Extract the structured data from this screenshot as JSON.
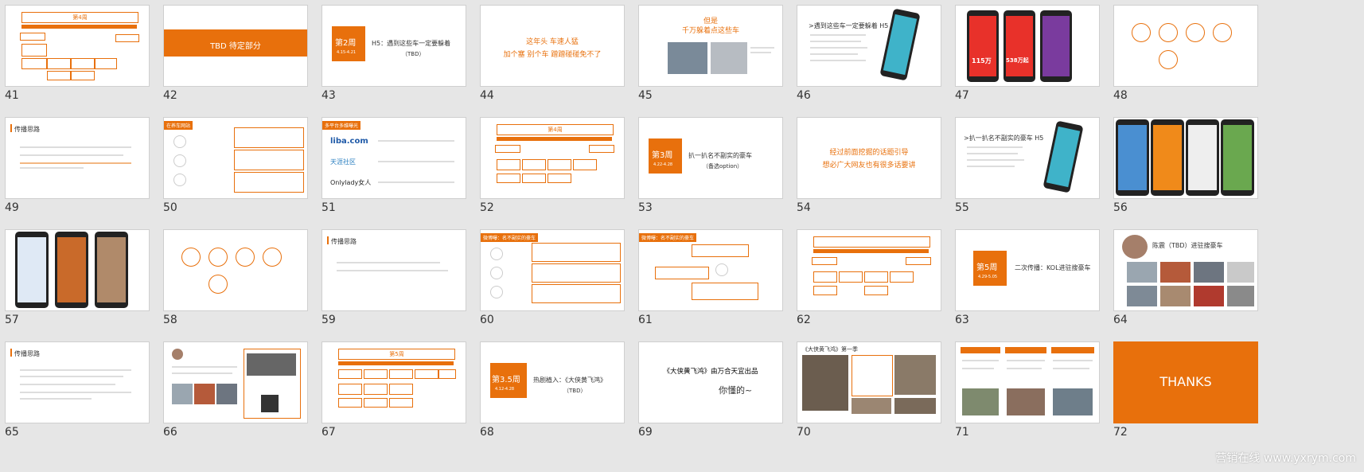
{
  "slides": [
    {
      "num": "41",
      "label": "第4周"
    },
    {
      "num": "42",
      "label": "TBD 待定部分"
    },
    {
      "num": "43",
      "week": "第2周",
      "date": "4.15-4.21",
      "title": "H5：遇到这些车一定要躲着",
      "sub": "（TBD）"
    },
    {
      "num": "44",
      "line1": "这年头 车速人猛",
      "line2": "加个塞 别个车 蹭蹭碰碰免不了"
    },
    {
      "num": "45",
      "line1": "但是",
      "line2": "千万躲着点这些车"
    },
    {
      "num": "46",
      "title": ">遇到这些车一定要躲着 H5"
    },
    {
      "num": "47",
      "price1": "115万",
      "price2": "538万起"
    },
    {
      "num": "48"
    },
    {
      "num": "49",
      "title": "传播思路"
    },
    {
      "num": "50",
      "tag": "在养车网站"
    },
    {
      "num": "51",
      "tag": "多平台多维曝光",
      "logo1": "liba.com",
      "logo2": "天涯社区",
      "logo3": "Onlylady女人"
    },
    {
      "num": "52",
      "label": "第4周"
    },
    {
      "num": "53",
      "week": "第3周",
      "date": "4.22-4.28",
      "title": "扒一扒名不副实的豪车",
      "sub": "（备选option）"
    },
    {
      "num": "54",
      "line1": "经过前面挖掘的话题引导",
      "line2": "想必广大网友也有很多话要讲"
    },
    {
      "num": "55",
      "title": ">扒一扒名不副实的豪车 H5"
    },
    {
      "num": "56"
    },
    {
      "num": "57"
    },
    {
      "num": "58"
    },
    {
      "num": "59",
      "title": "传播思路"
    },
    {
      "num": "60",
      "tag": "微博曝：名不副实的豪车"
    },
    {
      "num": "61",
      "tag": "微博曝：名不副实的豪车"
    },
    {
      "num": "62"
    },
    {
      "num": "63",
      "week": "第5周",
      "date": "4.29-5.05",
      "title": "二次传播：KOL进驻搜豪车"
    },
    {
      "num": "64",
      "title": "陈震（TBD）进驻搜豪车"
    },
    {
      "num": "65",
      "title": "传播思路"
    },
    {
      "num": "66"
    },
    {
      "num": "67",
      "label": "第5周"
    },
    {
      "num": "68",
      "week": "第3.5周",
      "date": "4.12-4.28",
      "title": "热剧植入：《大侠黄飞鸿》",
      "sub": "（TBD）"
    },
    {
      "num": "69",
      "line1": "《大侠黄飞鸿》由万合天宜出品",
      "line2": "你懂的~"
    },
    {
      "num": "70",
      "title": "《大侠黄飞鸿》第一季"
    },
    {
      "num": "71"
    },
    {
      "num": "72",
      "label": "THANKS"
    }
  ],
  "watermark": "营销在线 www.yxrym.com",
  "colors": {
    "accent": "#e8700c",
    "background": "#e6e6e6"
  }
}
